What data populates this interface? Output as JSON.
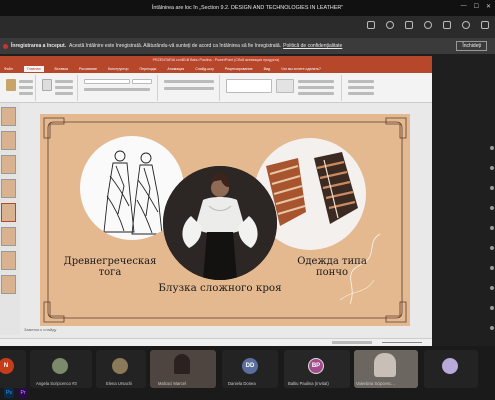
{
  "window": {
    "title": "Întâlnirea are loc în „Section 9.2. DESIGN AND TECHNOLOGIES IN LEATHER”",
    "controls": [
      "—",
      "☐",
      "✕"
    ]
  },
  "banner": {
    "bold": "Înregistrarea a început.",
    "text": "Acestă întâlnire este înregistrată. Alăturându-vă sunteți de acord ca întâlnirea să fie înregistrată.",
    "link": "Politică de confidențialitate",
    "button": "Închideți"
  },
  "powerpoint": {
    "title": "PRZENTARIA conВЪВ Babu Paulina - PowerPoint (Сбой активации продукта)",
    "tabs": [
      "Файл",
      "Главная",
      "Вставка",
      "Рисование",
      "Конструктор",
      "Переходы",
      "Анимация",
      "Слайд-шоу",
      "Рецензирование",
      "Вид",
      "Что вы хотите сделать?"
    ],
    "active_tab": "Главная",
    "notes_placeholder": "Заметки к слайду"
  },
  "slide": {
    "caption_left": "Древнегреческая тога",
    "caption_middle": "Блузка сложного кроя",
    "caption_right": "Одежда типа пончо"
  },
  "participants": [
    {
      "initials": "N",
      "name": "",
      "color": "#c43e1c"
    },
    {
      "initials": "",
      "name": "Angela Scripcenco #3",
      "color": "#7a8a6a"
    },
    {
      "initials": "",
      "name": "Elena Ursachi",
      "color": "#8a7a5a"
    },
    {
      "initials": "",
      "name": "Malcoci Marcel",
      "color": "#3a3a3a"
    },
    {
      "initials": "DD",
      "name": "Daniela Donea",
      "color": "#5b6f9e"
    },
    {
      "initials": "BP",
      "name": "Baltiu Paulina (Invitat)",
      "color": "#a14d8b"
    },
    {
      "initials": "",
      "name": "Valentina Scipcenc...",
      "color": "#b0a090"
    },
    {
      "initials": "",
      "name": "",
      "color": "#b9a9d9"
    }
  ],
  "taskbar": [
    "Ps",
    "Pr"
  ]
}
